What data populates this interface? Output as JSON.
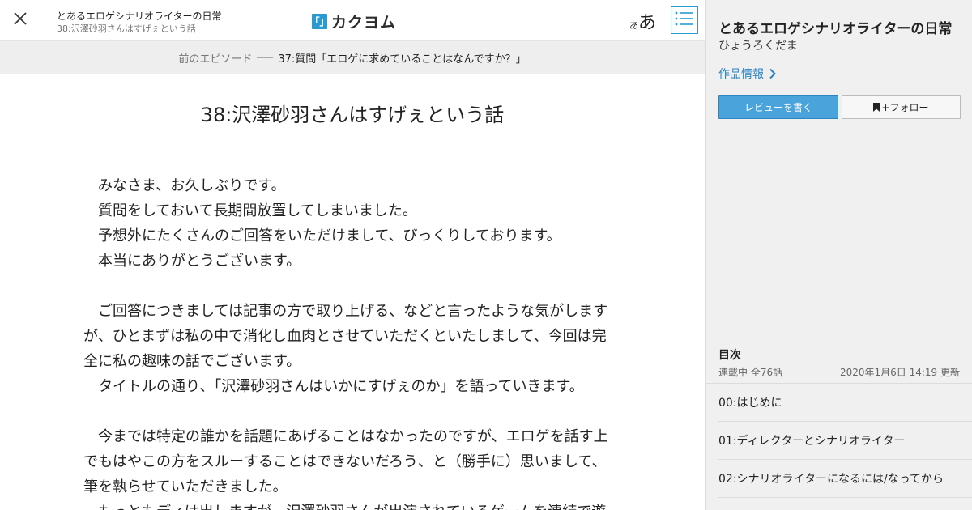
{
  "header": {
    "work_title": "とあるエロゲシナリオライターの日常",
    "episode_subtitle": "38:沢澤砂羽さんはすげぇという話",
    "logo_mark": "「」",
    "logo_text": "カクヨム",
    "font_size_small": "あ",
    "font_size_big": "あ"
  },
  "prev_bar": {
    "label": "前のエピソード",
    "link_text": "37:質問「エロゲに求めていることはなんですか？」"
  },
  "main": {
    "episode_title": "38:沢澤砂羽さんはすげぇという話",
    "paragraphs": [
      "　みなさま、お久しぶりです。",
      "　質問をしておいて長期間放置してしまいました。",
      "　予想外にたくさんのご回答をいただけまして、びっくりしております。",
      "　本当にありがとうございます。",
      "",
      "　ご回答につきましては記事の方で取り上げる、などと言ったような気がします",
      "が、ひとまずは私の中で消化し血肉とさせていただくといたしまして、今回は完",
      "全に私の趣味の話でございます。",
      "　タイトルの通り、「沢澤砂羽さんはいかにすげぇのか」を語っていきます。",
      "",
      "　今までは特定の誰かを話題にあげることはなかったのですが、エロゲを話す上",
      "でもはやこの方をスルーすることはできないだろう、と（勝手に）思いまして、",
      "筆を執らせていただきました。",
      "　もっともディは出しますが、沢澤砂羽さんが出演されているゲームを連続で遊"
    ]
  },
  "sidebar": {
    "title": "とあるエロゲシナリオライターの日常",
    "author": "ひょうろくだま",
    "info_link": "作品情報",
    "review_button": "レビューを書く",
    "follow_button": "+フォロー",
    "toc_heading": "目次",
    "toc_status": "連載中 全76話",
    "toc_updated": "2020年1月6日 14:19 更新",
    "toc_items": [
      "00:はじめに",
      "01:ディレクターとシナリオライター",
      "02:シナリオライターになるには/なってから"
    ]
  },
  "colors": {
    "accent": "#2a9ad3",
    "review_button_bg": "#4aa3db",
    "link": "#2a83c4",
    "sidebar_bg": "#f0f0f0",
    "prev_bar_bg": "#eeeeee"
  },
  "icons": {
    "close": "close-icon",
    "toc": "list-icon",
    "chevron": "chevron-right-icon",
    "bookmark": "bookmark-icon"
  }
}
